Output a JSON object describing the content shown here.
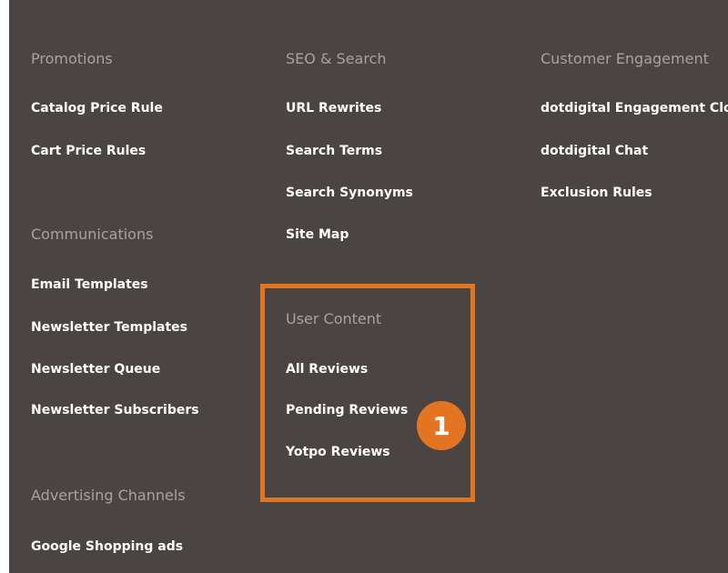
{
  "columns": [
    {
      "groups": [
        {
          "heading": "Promotions",
          "items": [
            "Catalog Price Rule",
            "Cart Price Rules"
          ]
        },
        {
          "heading": "Communications",
          "items": [
            "Email Templates",
            "Newsletter Templates",
            "Newsletter Queue",
            "Newsletter Subscribers"
          ]
        },
        {
          "heading": "Advertising Channels",
          "items": [
            "Google Shopping ads"
          ]
        }
      ]
    },
    {
      "groups": [
        {
          "heading": "SEO & Search",
          "items": [
            "URL Rewrites",
            "Search Terms",
            "Search Synonyms",
            "Site Map"
          ]
        },
        {
          "heading": "User Content",
          "items": [
            "All Reviews",
            "Pending Reviews",
            "Yotpo Reviews"
          ]
        }
      ]
    },
    {
      "groups": [
        {
          "heading": "Customer Engagement",
          "items": [
            "dotdigital Engagement Cloud",
            "dotdigital Chat",
            "Exclusion Rules"
          ]
        }
      ]
    }
  ],
  "callout": {
    "label": "1",
    "color": "#e37422"
  },
  "colors": {
    "panel_background": "#4a4542",
    "heading": "#a7a29e",
    "link": "#ffffff",
    "highlight": "#e37422"
  }
}
